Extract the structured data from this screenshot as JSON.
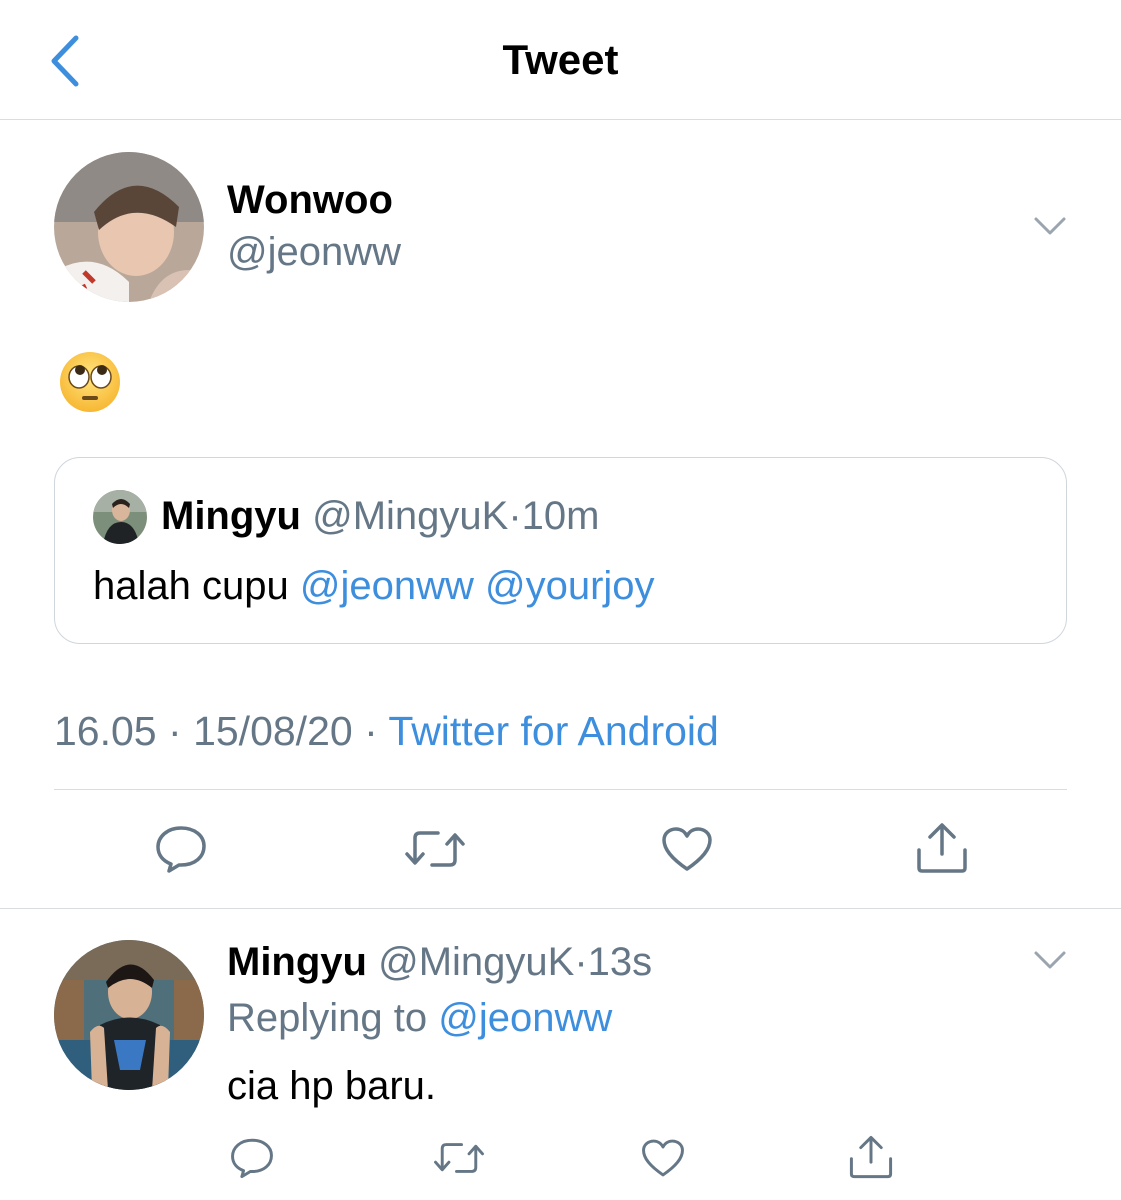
{
  "nav": {
    "title": "Tweet"
  },
  "tweet": {
    "author_name": "Wonwoo",
    "author_handle": "@jeonww",
    "emoji_icon": "face-with-rolling-eyes",
    "quote": {
      "author_name": "Mingyu",
      "author_handle": "@MingyuK",
      "sep": "·",
      "time": "10m",
      "text": "halah cupu",
      "mentions": [
        "@jeonww",
        "@yourjoy"
      ]
    },
    "time": "16.05",
    "date": "15/08/20",
    "sep": "·",
    "source": "Twitter for Android"
  },
  "reply": {
    "author_name": "Mingyu",
    "author_handle": "@MingyuK",
    "sep": "·",
    "time": "13s",
    "replying_label": "Replying to",
    "replying_handle": "@jeonww",
    "text": "cia hp baru."
  },
  "colors": {
    "accent": "#3e8ede",
    "secondary_text": "#657786",
    "icon": "#657786",
    "divider": "#d9dde0"
  }
}
